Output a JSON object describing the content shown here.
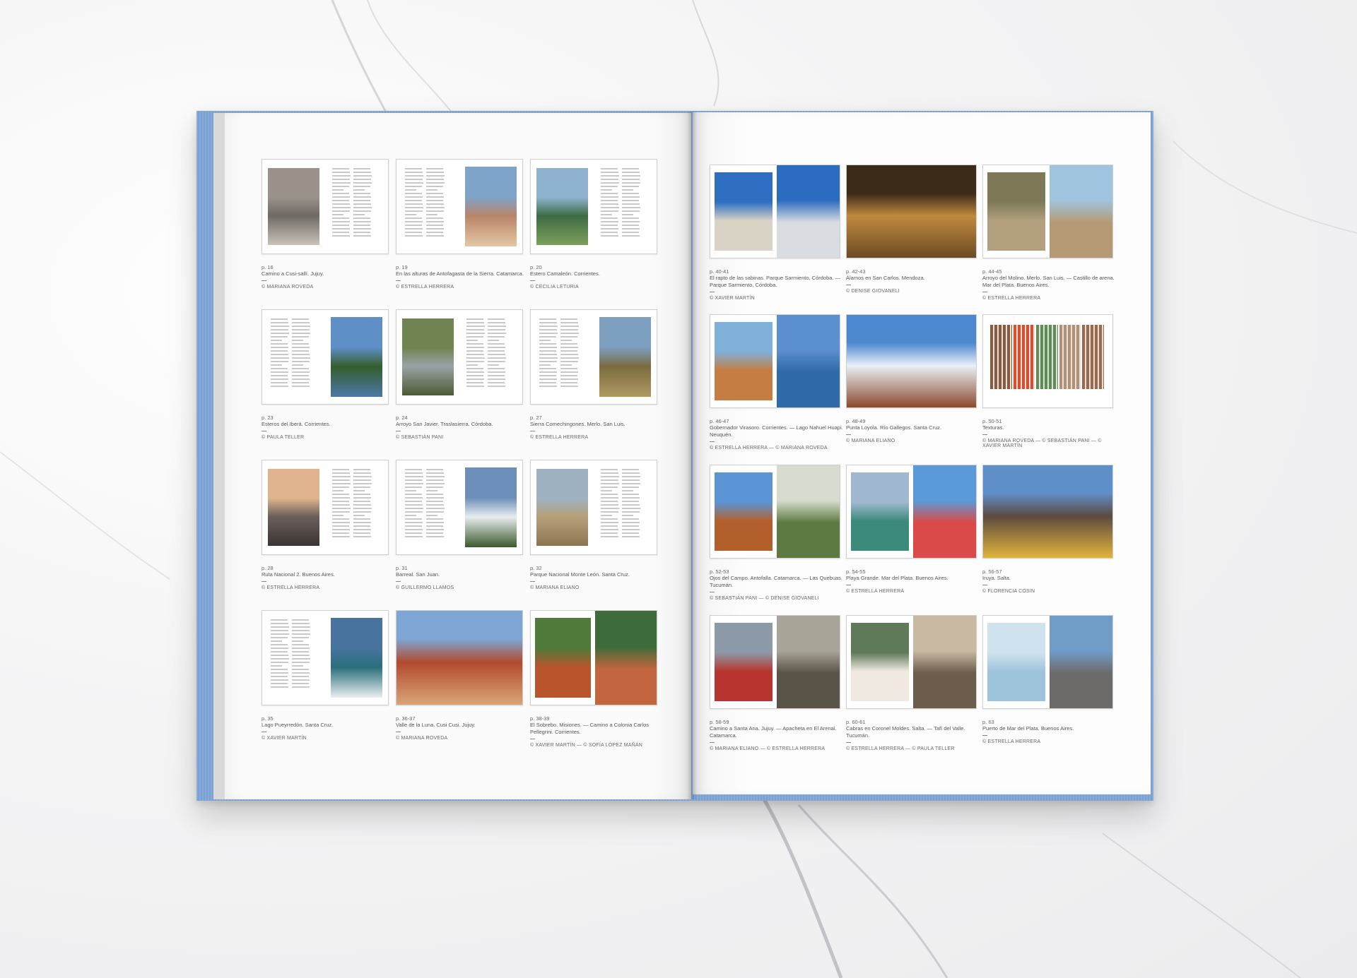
{
  "left_page": {
    "entries": [
      {
        "page": "p. 16",
        "caption": "Camino a Cusi-sallí. Jujuy.",
        "credit": "© MARIANA ROVEDA",
        "layout": "img-left",
        "colors": [
          "#9a9288",
          "#6e6a64",
          "#c9c3b8"
        ]
      },
      {
        "page": "p. 19",
        "caption": "En las alturas de Antofagasta de la Sierra. Catamarca.",
        "credit": "© ESTRELLA HERRERA",
        "layout": "img-right",
        "colors": [
          "#7ea4c9",
          "#b98568",
          "#e3c8a6"
        ]
      },
      {
        "page": "p. 20",
        "caption": "Estero Camaleón. Corrientes.",
        "credit": "© CECILIA LETURIA",
        "layout": "img-left",
        "colors": [
          "#8fb3cf",
          "#3d6b44",
          "#7da05a"
        ]
      },
      {
        "page": "p. 23",
        "caption": "Esteros del Iberá. Corrientes.",
        "credit": "© PAULA TELLER",
        "layout": "img-right",
        "colors": [
          "#5f8fc7",
          "#345e2c",
          "#4c77a6"
        ]
      },
      {
        "page": "p. 24",
        "caption": "Arroyo San Javier. Traslasierra. Córdoba.",
        "credit": "© SEBASTIÁN PANI",
        "layout": "img-left",
        "colors": [
          "#6f8450",
          "#9aa3a6",
          "#4b5a33"
        ]
      },
      {
        "page": "p. 27",
        "caption": "Sierra Comechingones. Merlo. San Luis.",
        "credit": "© ESTRELLA HERRERA",
        "layout": "img-right",
        "colors": [
          "#7d9fc0",
          "#7a6b3e",
          "#b09a62"
        ]
      },
      {
        "page": "p. 28",
        "caption": "Ruta Nacional 2. Buenos Aires.",
        "credit": "© ESTRELLA HERRERA",
        "layout": "img-left",
        "colors": [
          "#e0b48e",
          "#6b5f5a",
          "#3b3433"
        ]
      },
      {
        "page": "p. 31",
        "caption": "Barreal. San Juan.",
        "credit": "© GUILLERMO LLAMOS",
        "layout": "img-right",
        "colors": [
          "#6b8fb8",
          "#e8ecef",
          "#3c5a2c"
        ]
      },
      {
        "page": "p. 32",
        "caption": "Parque Nacional Monte León. Santa Cruz.",
        "credit": "© MARIANA ELIANO",
        "layout": "img-left",
        "colors": [
          "#9fb2c2",
          "#b6a07a",
          "#8c7452"
        ]
      },
      {
        "page": "p. 35",
        "caption": "Lago Pueyrredón. Santa Cruz.",
        "credit": "© XAVIER MARTÍN",
        "layout": "img-right",
        "colors": [
          "#48739f",
          "#2a6f7a",
          "#e9eef2"
        ]
      },
      {
        "page": "p. 36-37",
        "caption": "Valle de la Luna. Cusi Cusi. Jujuy.",
        "credit": "© MARIANA ROVEDA",
        "layout": "full",
        "colors": [
          "#7ea6d5",
          "#b24a2c",
          "#d8a47a"
        ]
      },
      {
        "page": "p. 38-39",
        "caption": "El Sobrebo. Misiones. — Camino a Colonia Carlos Pellegrini. Corrientes.",
        "credit": "© XAVIER MARTÍN — © SOFÍA LÓPEZ MAÑÁN",
        "layout": "two",
        "colors": [
          "#4f7a3a",
          "#b9552d",
          "#3d6b3a",
          "#c1663e"
        ]
      }
    ]
  },
  "right_page": {
    "entries": [
      {
        "page": "p. 40-41",
        "caption": "El rapto de las sabinas. Parque Sarmiento, Córdoba. — Parque Sarmiento, Córdoba.",
        "credit": "© XAVIER MARTÍN",
        "layout": "two",
        "colors": [
          "#2e6fc2",
          "#d9d3c6",
          "#2b6cc0",
          "#d9dde2"
        ]
      },
      {
        "page": "p. 42-43",
        "caption": "Álamos en San Carlos. Mendoza.",
        "credit": "© DENISE GIOVANELI",
        "layout": "full",
        "colors": [
          "#3a2a17",
          "#c08a3e",
          "#6b4b24"
        ]
      },
      {
        "page": "p. 44-45",
        "caption": "Arroyo del Molino. Merlo. San Luis. — Castillo de arena. Mar del Plata. Buenos Aires.",
        "credit": "© ESTRELLA HERRERA",
        "layout": "two",
        "colors": [
          "#7e7a58",
          "#b3a07e",
          "#9fc4de",
          "#b69a74"
        ]
      },
      {
        "page": "p. 46-47",
        "caption": "Gobernador Virasoro. Corrientes. — Lago Nahuel Huapi. Neuquén.",
        "credit": "© ESTRELLA HERRERA — © MARIANA ROVEDA",
        "layout": "two",
        "colors": [
          "#7fb0d9",
          "#c57d43",
          "#5c8fcf",
          "#2f6aa8"
        ]
      },
      {
        "page": "p. 48-49",
        "caption": "Punta Loyola. Río Gallegos. Santa Cruz.",
        "credit": "© MARIANA ELIANO",
        "layout": "full",
        "colors": [
          "#4c88cf",
          "#e9f0f7",
          "#8c4a2b"
        ]
      },
      {
        "page": "p. 50-51",
        "caption": "Texturas.",
        "credit": "© MARIANA ROVEDA — © SEBASTIÁN PANI — © XAVIER MARTÍN",
        "layout": "strip",
        "colors": [
          "#8b5a3c",
          "#d94f2e",
          "#5e8e54",
          "#b38f73",
          "#9c6a4a"
        ]
      },
      {
        "page": "p. 52-53",
        "caption": "Ojos del Campo. Antofalla. Catamarca. — Las Quebuas. Tucumán.",
        "credit": "© SEBASTIÁN PANI — © DENISE GIOVANELI",
        "layout": "two",
        "colors": [
          "#5b95d6",
          "#b35f2c",
          "#d7dccf",
          "#5c7a42"
        ]
      },
      {
        "page": "p. 54-55",
        "caption": "Playa Grande. Mar del Plata. Buenos Aires.",
        "credit": "© ESTRELLA HERRERA",
        "layout": "two",
        "colors": [
          "#9fb8cf",
          "#3b8a7a",
          "#5b9ad9",
          "#d94a48"
        ]
      },
      {
        "page": "p. 56-57",
        "caption": "Iruya. Salta.",
        "credit": "© FLORENCIA COSIN",
        "layout": "full",
        "colors": [
          "#5e8fc8",
          "#5d4a40",
          "#e0b43a"
        ]
      },
      {
        "page": "p. 58-59",
        "caption": "Camino a Santa Ana. Jujuy. — Apacheta en El Arenal. Catamarca.",
        "credit": "© MARIANA ELIANO — © ESTRELLA HERRERA",
        "layout": "two",
        "colors": [
          "#8c9aa7",
          "#b7352e",
          "#a8a497",
          "#5a5347"
        ]
      },
      {
        "page": "p. 60-61",
        "caption": "Cabras en Coronel Moldes. Salta. — Tafí del Valle. Tucumán.",
        "credit": "© ESTRELLA HERRERA — © PAULA TELLER",
        "layout": "two",
        "colors": [
          "#5f7a58",
          "#efe9e2",
          "#c9b9a3",
          "#6b5c4b"
        ]
      },
      {
        "page": "p. 63",
        "caption": "Puerto de Mar del Plata. Buenos Aires.",
        "credit": "© ESTRELLA HERRERA",
        "layout": "two",
        "colors": [
          "#cfe3ef",
          "#9ec4dc",
          "#6f9dc8",
          "#6d6b6a"
        ]
      }
    ]
  }
}
